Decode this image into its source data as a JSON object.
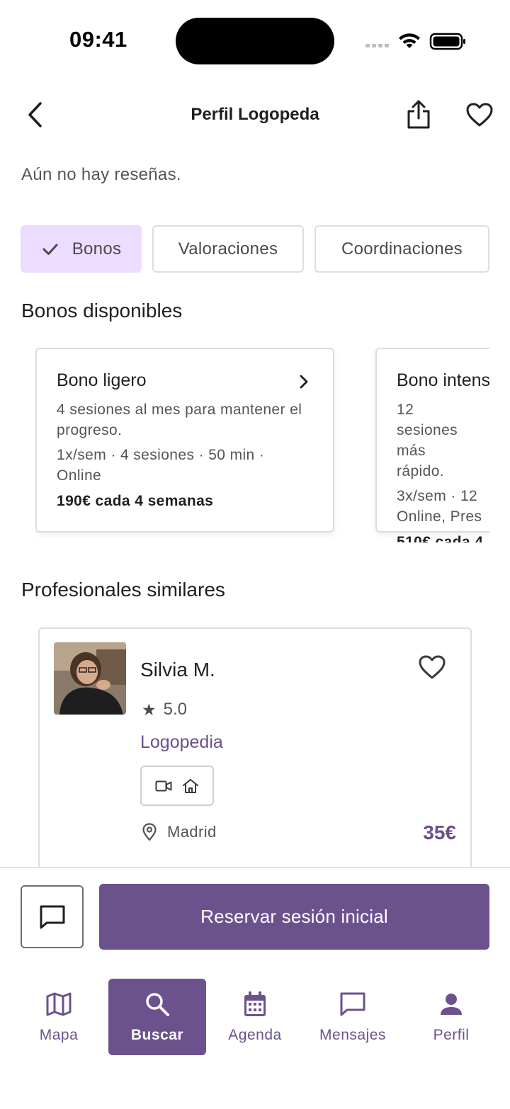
{
  "status_bar": {
    "time": "09:41"
  },
  "header": {
    "title": "Perfil Logopeda"
  },
  "reviews": {
    "empty_text": "Aún no hay reseñas."
  },
  "tabs": [
    {
      "label": "Bonos",
      "selected": true
    },
    {
      "label": "Valoraciones",
      "selected": false
    },
    {
      "label": "Coordinaciones",
      "selected": false
    }
  ],
  "bonos_section": {
    "title": "Bonos disponibles",
    "items": [
      {
        "name": "Bono ligero",
        "description": "4 sesiones al mes para mantener el progreso.",
        "meta": "1x/sem · 4 sesiones · 50 min · Online",
        "price": "190€ cada 4 semanas"
      },
      {
        "name": "Bono intens",
        "description": "12 sesiones más rápido.",
        "meta": "3x/sem · 12 Online, Pres",
        "price": "510€ cada 4"
      }
    ]
  },
  "similar_section": {
    "title": "Profesionales similares",
    "items": [
      {
        "name": "Silvia M.",
        "rating": "5.0",
        "rating_icon": "★",
        "specialty": "Logopedia",
        "modes": [
          "video-icon",
          "home-icon"
        ],
        "location": "Madrid",
        "price": "35€"
      }
    ]
  },
  "actions": {
    "book_label": "Reservar sesión inicial"
  },
  "nav": [
    {
      "label": "Mapa",
      "icon": "map-icon",
      "active": false
    },
    {
      "label": "Buscar",
      "icon": "search-icon",
      "active": true
    },
    {
      "label": "Agenda",
      "icon": "calendar-icon",
      "active": false
    },
    {
      "label": "Mensajes",
      "icon": "message-icon",
      "active": false
    },
    {
      "label": "Perfil",
      "icon": "person-icon",
      "active": false
    }
  ],
  "colors": {
    "accent": "#6c528d",
    "chip_selected": "#ecdcff"
  }
}
